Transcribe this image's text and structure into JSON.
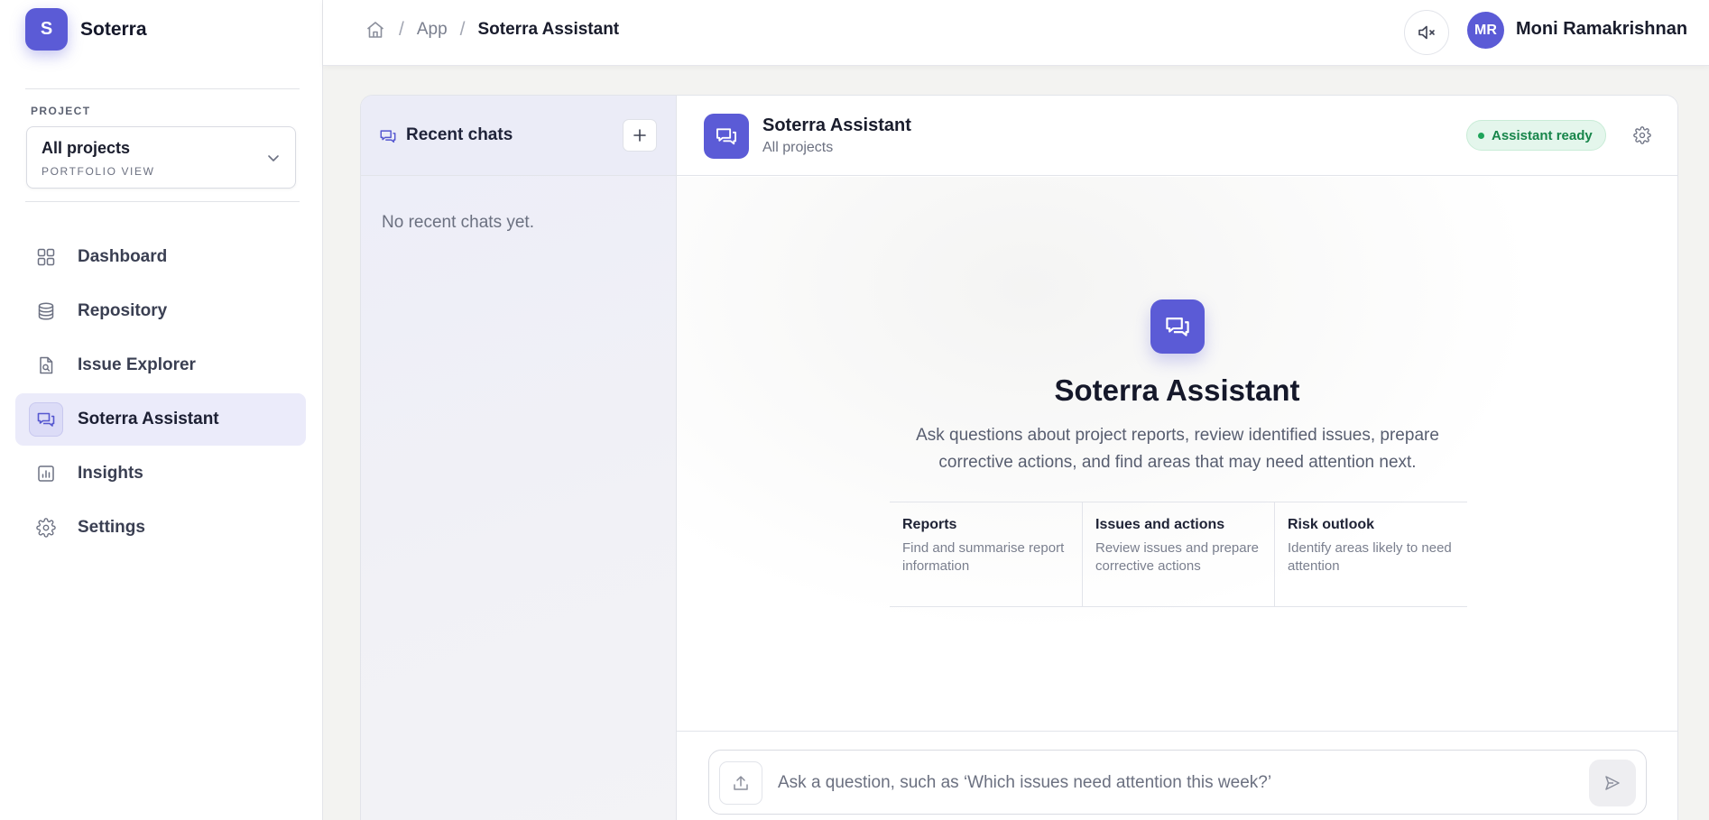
{
  "brand": {
    "logo_letter": "S",
    "name": "Soterra"
  },
  "project": {
    "label": "PROJECT",
    "selected": "All projects",
    "subtitle": "PORTFOLIO VIEW"
  },
  "nav": {
    "items": [
      {
        "label": "Dashboard",
        "icon": "grid-icon",
        "active": false
      },
      {
        "label": "Repository",
        "icon": "database-icon",
        "active": false
      },
      {
        "label": "Issue Explorer",
        "icon": "file-search-icon",
        "active": false
      },
      {
        "label": "Soterra Assistant",
        "icon": "chat-bubbles-icon",
        "active": true
      },
      {
        "label": "Insights",
        "icon": "bar-chart-icon",
        "active": false
      },
      {
        "label": "Settings",
        "icon": "gear-icon",
        "active": false
      }
    ]
  },
  "breadcrumb": {
    "items": [
      "App",
      "Soterra Assistant"
    ]
  },
  "user": {
    "initials": "MR",
    "name": "Moni Ramakrishnan"
  },
  "chats": {
    "title": "Recent chats",
    "empty": "No recent chats yet."
  },
  "assistant": {
    "title": "Soterra Assistant",
    "scope": "All projects",
    "status": "Assistant ready",
    "hero_title": "Soterra Assistant",
    "hero_desc": "Ask questions about project reports, review identified issues, prepare corrective actions, and find areas that may need attention next.",
    "capabilities": [
      {
        "title": "Reports",
        "desc": "Find and summarise report information"
      },
      {
        "title": "Issues and actions",
        "desc": "Review issues and prepare corrective actions"
      },
      {
        "title": "Risk outlook",
        "desc": "Identify areas likely to need attention"
      }
    ]
  },
  "composer": {
    "placeholder": "Ask a question, such as ‘Which issues need attention this week?’",
    "value": ""
  },
  "colors": {
    "accent": "#5b5bd6",
    "status_green": "#17854a",
    "active_nav_bg": "#ebebfa"
  }
}
